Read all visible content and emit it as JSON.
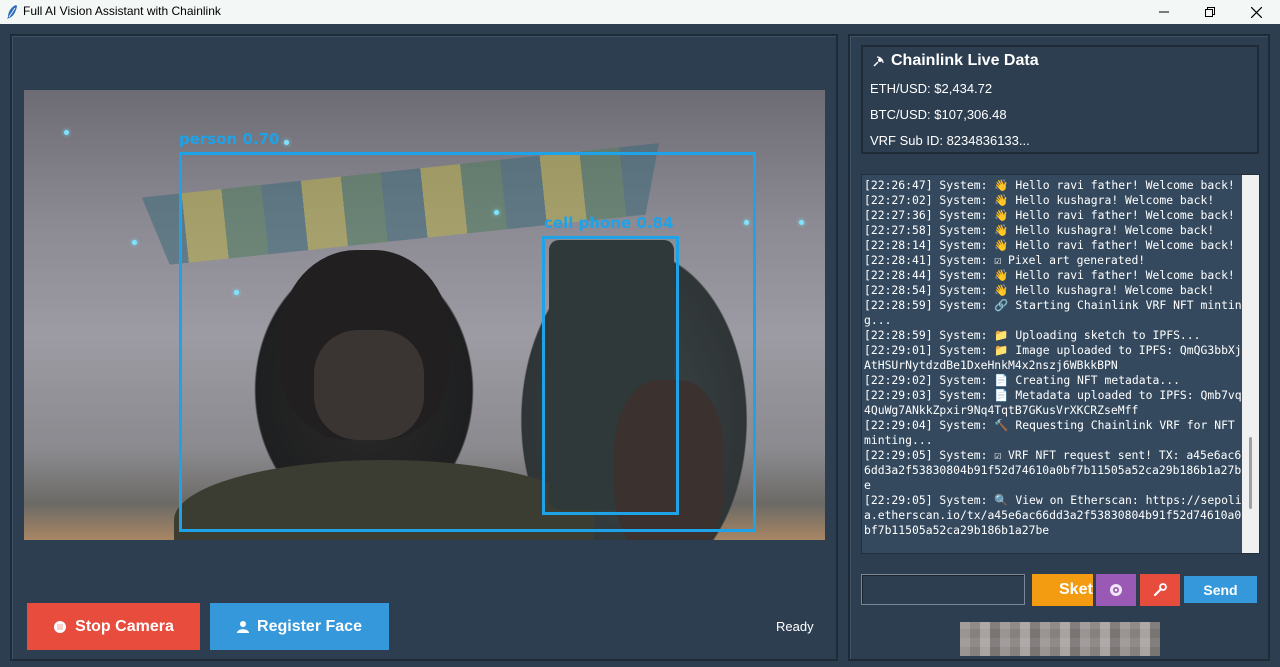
{
  "window": {
    "title": "Full AI Vision Assistant with Chainlink"
  },
  "camera": {
    "detections": [
      {
        "label": "person 0.70"
      },
      {
        "label": "cell phone 0.84"
      }
    ]
  },
  "controls": {
    "stop_camera_label": "Stop Camera",
    "register_face_label": "Register Face",
    "status": "Ready"
  },
  "chainlink": {
    "title": "Chainlink Live Data",
    "eth_usd": "ETH/USD: $2,434.72",
    "btc_usd": "BTC/USD: $107,306.48",
    "vrf_sub": "VRF Sub ID: 8234836133..."
  },
  "chat_log": {
    "text": "[22:26:47] System: 👋 Hello ravi father! Welcome back!\n[22:27:02] System: 👋 Hello kushagra! Welcome back!\n[22:27:36] System: 👋 Hello ravi father! Welcome back!\n[22:27:58] System: 👋 Hello kushagra! Welcome back!\n[22:28:14] System: 👋 Hello ravi father! Welcome back!\n[22:28:41] System: ☑ Pixel art generated!\n[22:28:44] System: 👋 Hello ravi father! Welcome back!\n[22:28:54] System: 👋 Hello kushagra! Welcome back!\n[22:28:59] System: 🔗 Starting Chainlink VRF NFT minting...\n[22:28:59] System: 📁 Uploading sketch to IPFS...\n[22:29:01] System: 📁 Image uploaded to IPFS: QmQG3bbXjAtHSUrNytdzdBe1DxeHnkM4x2nszj6WBkkBPN\n[22:29:02] System: 📄 Creating NFT metadata...\n[22:29:03] System: 📄 Metadata uploaded to IPFS: Qmb7vq4QuWg7ANkkZpxir9Nq4TqtB7GKusVrXKCRZseMff\n[22:29:04] System: 🔨 Requesting Chainlink VRF for NFT minting...\n[22:29:05] System: ☑ VRF NFT request sent! TX: a45e6ac66dd3a2f53830804b91f52d74610a0bf7b11505a52ca29b186b1a27be\n[22:29:05] System: 🔍 View on Etherscan: https://sepolia.etherscan.io/tx/a45e6ac66dd3a2f53830804b91f52d74610a0bf7b11505a52ca29b186b1a27be"
  },
  "chat_input": {
    "value": ""
  },
  "buttons": {
    "sketch_label": "Sketch",
    "send_label": "Send"
  },
  "colors": {
    "background": "#2c3e50",
    "stop": "#e74c3c",
    "register": "#3498db",
    "sketch": "#f39c12",
    "vision": "#9b59b6",
    "detection_box": "#1ea2e8"
  }
}
